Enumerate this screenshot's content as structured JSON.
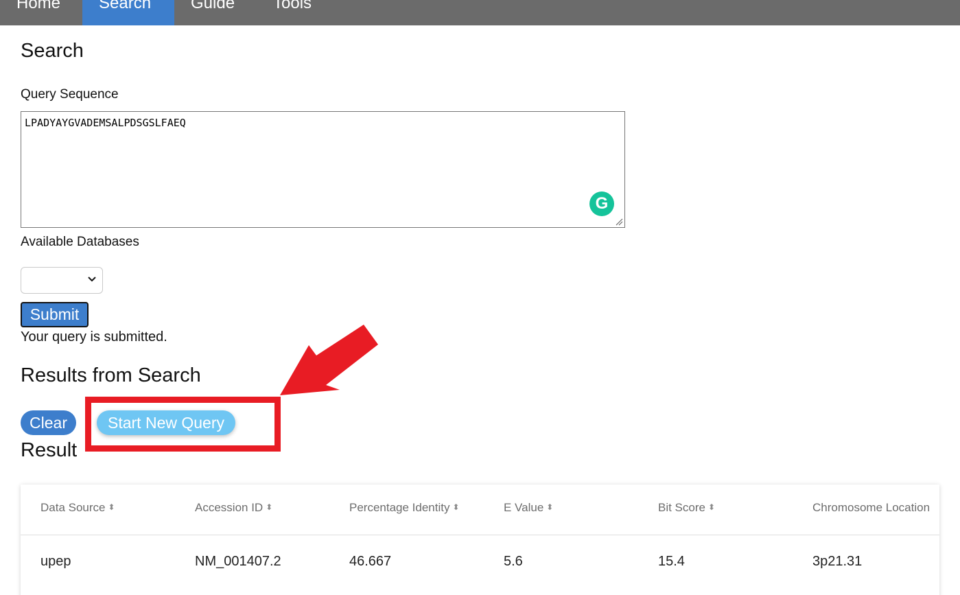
{
  "nav": {
    "items": [
      {
        "label": "Home"
      },
      {
        "label": "Search"
      },
      {
        "label": "Guide"
      },
      {
        "label": "Tools"
      }
    ],
    "active": "Search"
  },
  "page": {
    "title": "Search"
  },
  "form": {
    "query_label": "Query Sequence",
    "query_value": "LPADYAYGVADEMSALPDSGSLFAEQ",
    "db_label": "Available Databases",
    "db_selected": "",
    "submit_label": "Submit",
    "status_text": "Your query is submitted."
  },
  "results": {
    "title": "Results from Search",
    "clear_label": "Clear",
    "new_query_label": "Start New Query",
    "result_title": "Result"
  },
  "table": {
    "columns": [
      "Data Source",
      "Accession ID",
      "Percentage Identity",
      "E Value",
      "Bit Score",
      "Chromosome Location"
    ],
    "rows": [
      [
        "upep",
        "NM_001407.2",
        "46.667",
        "5.6",
        "15.4",
        "3p21.31"
      ]
    ]
  },
  "colors": {
    "navbar": "#6b6b6b",
    "active_tab": "#3d7ecc",
    "primary_button": "#3d7ecc",
    "new_query_button": "#6fc6f3",
    "annotation_red": "#e81c24",
    "grammarly": "#15c39a"
  },
  "icons": {
    "grammarly": "grammarly-icon",
    "select_arrow": "chevron-down-icon",
    "sort": "sort-icon"
  }
}
